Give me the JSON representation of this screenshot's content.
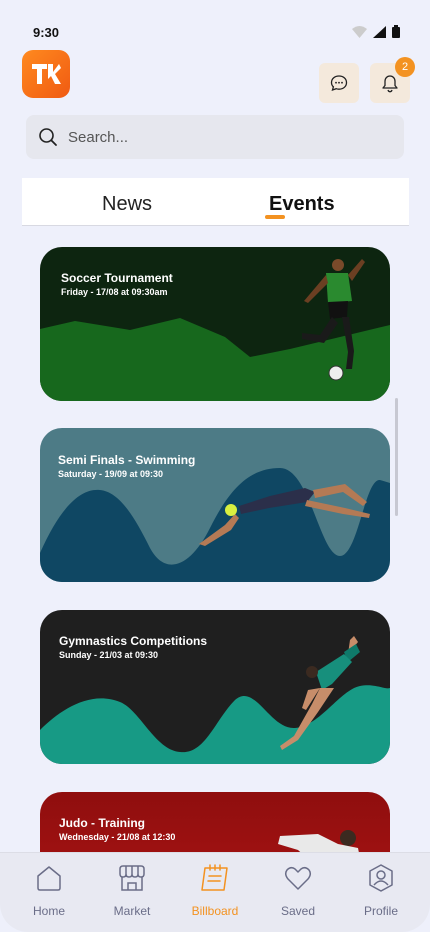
{
  "status_bar": {
    "time": "9:30"
  },
  "header": {
    "logo_text": "TK",
    "notification_count": "2"
  },
  "search": {
    "placeholder": "Search..."
  },
  "tabs": [
    {
      "label": "News",
      "active": false
    },
    {
      "label": "Events",
      "active": true
    }
  ],
  "events": [
    {
      "title": "Soccer Tournament",
      "date": "Friday - 17/08 at 09:30am",
      "bg": "#0d2510",
      "wave": "#17681d"
    },
    {
      "title": "Semi Finals - Swimming",
      "date": "Saturday - 19/09 at 09:30",
      "bg": "#4d7b86",
      "wave": "#0f4763"
    },
    {
      "title": "Gymnastics Competitions",
      "date": "Sunday - 21/03 at 09:30",
      "bg": "#1f1f1f",
      "wave": "#179a85"
    },
    {
      "title": "Judo - Training",
      "date": "Wednesday - 21/08 at 12:30",
      "bg": "#8f0e0e",
      "wave": "#b31616"
    }
  ],
  "bottom_nav": [
    {
      "label": "Home",
      "icon": "home-icon",
      "active": false
    },
    {
      "label": "Market",
      "icon": "market-icon",
      "active": false
    },
    {
      "label": "Billboard",
      "icon": "billboard-icon",
      "active": true
    },
    {
      "label": "Saved",
      "icon": "heart-icon",
      "active": false
    },
    {
      "label": "Profile",
      "icon": "profile-icon",
      "active": false
    }
  ],
  "colors": {
    "accent": "#f39221",
    "background": "#eef0fb"
  }
}
